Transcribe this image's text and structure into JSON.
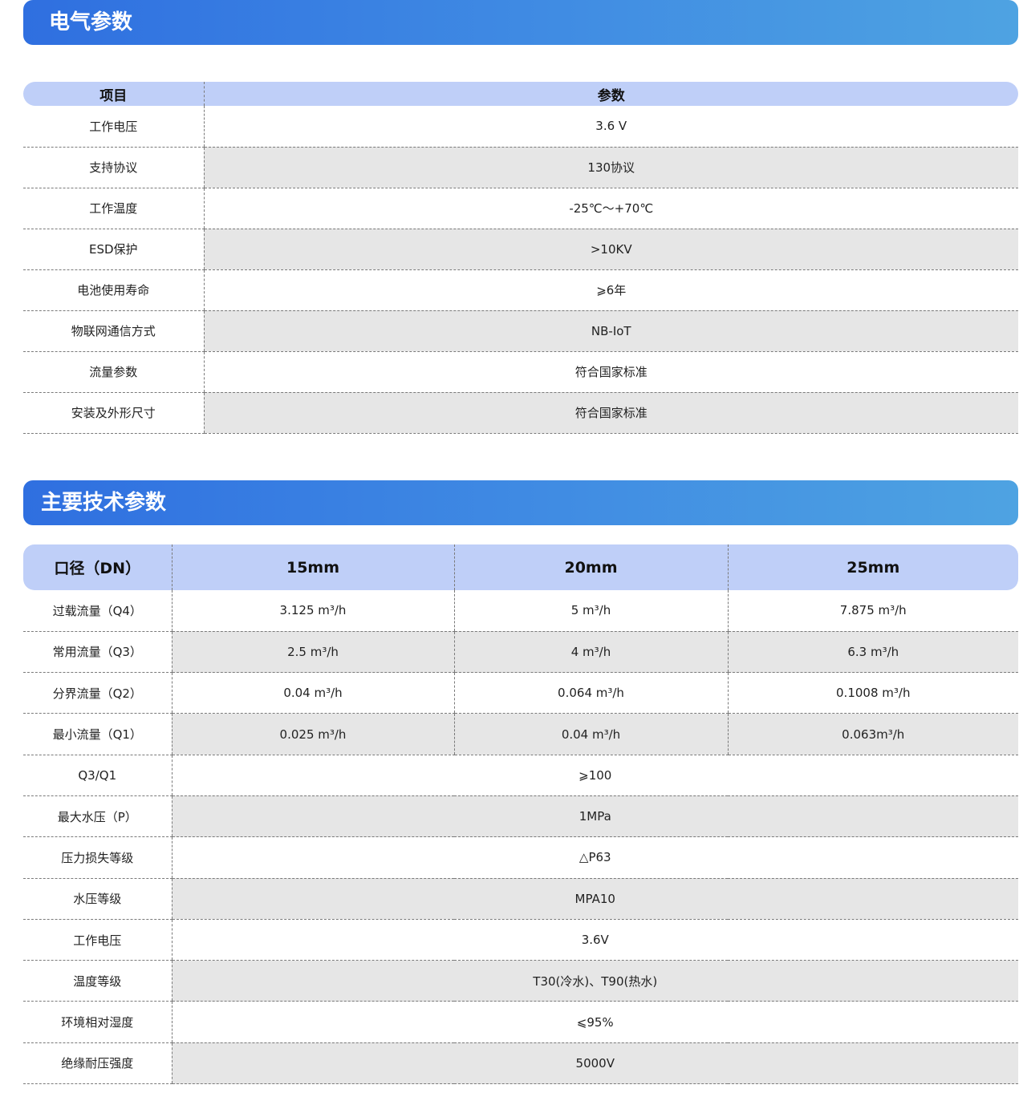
{
  "section1": {
    "title": "电气参数",
    "headers": [
      "项目",
      "参数"
    ],
    "rows": [
      [
        "工作电压",
        "3.6 V"
      ],
      [
        "支持协议",
        "130协议"
      ],
      [
        "工作温度",
        "-25℃～+70℃"
      ],
      [
        "ESD保护",
        ">10KV"
      ],
      [
        "电池使用寿命",
        "⩾6年"
      ],
      [
        "物联网通信方式",
        "NB-IoT"
      ],
      [
        "流量参数",
        "符合国家标准"
      ],
      [
        "安装及外形尺寸",
        "符合国家标准"
      ]
    ]
  },
  "section2": {
    "title": "主要技术参数",
    "headers": [
      "口径（DN）",
      "15mm",
      "20mm",
      "25mm"
    ],
    "flow_rows": [
      {
        "label": "过载流量（Q4）",
        "values": [
          "3.125 m³/h",
          "5 m³/h",
          "7.875 m³/h"
        ]
      },
      {
        "label": "常用流量（Q3）",
        "values": [
          "2.5 m³/h",
          "4 m³/h",
          "6.3 m³/h"
        ]
      },
      {
        "label": "分界流量（Q2）",
        "values": [
          "0.04 m³/h",
          "0.064 m³/h",
          "0.1008 m³/h"
        ]
      },
      {
        "label": "最小流量（Q1）",
        "values": [
          "0.025 m³/h",
          "0.04 m³/h",
          "0.063m³/h"
        ]
      }
    ],
    "spec_rows": [
      {
        "label": "Q3/Q1",
        "value": "⩾100"
      },
      {
        "label": "最大水压（P）",
        "value": "1MPa"
      },
      {
        "label": "压力损失等级",
        "value": "△P63"
      },
      {
        "label": "水压等级",
        "value": "MPA10"
      },
      {
        "label": "工作电压",
        "value": "3.6V"
      },
      {
        "label": "温度等级",
        "value": "T30(冷水)、T90(热水)"
      },
      {
        "label": "环境相对湿度",
        "value": "⩽95%"
      },
      {
        "label": "绝缘耐压强度",
        "value": "5000V"
      }
    ]
  }
}
